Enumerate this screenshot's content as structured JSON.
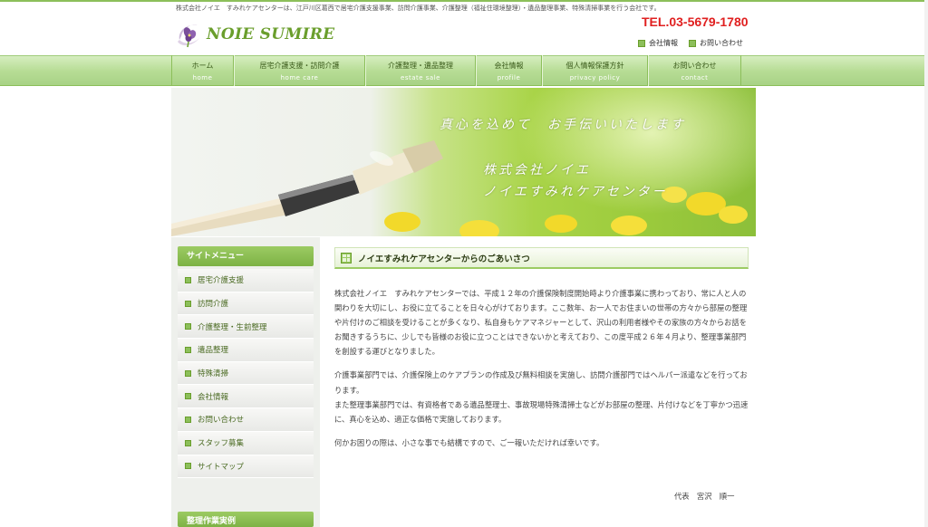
{
  "header": {
    "tagline": "株式会社ノイエ　すみれケアセンターは、江戸川区葛西で居宅介護支援事業、訪問介護事業、介護整理（福祉住環境整理）・遺品整理事業、特殊清掃事業を行う会社です。",
    "logo_text": "NOIE SUMIRE",
    "tel": "TEL.03-5679-1780",
    "links": [
      {
        "label": "会社情報",
        "icon": "square-bullet-icon"
      },
      {
        "label": "お問い合わせ",
        "icon": "square-bullet-icon"
      }
    ]
  },
  "nav": [
    {
      "jp": "ホーム",
      "en": "home"
    },
    {
      "jp": "居宅介護支援・訪問介護",
      "en": "home care"
    },
    {
      "jp": "介護整理・遺品整理",
      "en": "estate sale"
    },
    {
      "jp": "会社情報",
      "en": "profile"
    },
    {
      "jp": "個人情報保護方針",
      "en": "privacy policy"
    },
    {
      "jp": "お問い合わせ",
      "en": "contact"
    }
  ],
  "hero": {
    "line1": "真心を込めて　お手伝いいたします",
    "line2": "株式会社ノイエ",
    "line3": "ノイエすみれケアセンター"
  },
  "sidebar": {
    "menu_title": "サイトメニュー",
    "items": [
      "居宅介護支援",
      "訪問介護",
      "介護整理・生前整理",
      "遺品整理",
      "特殊清掃",
      "会社情報",
      "お問い合わせ",
      "スタッフ募集",
      "サイトマップ"
    ],
    "section2_title": "整理作業実例"
  },
  "main": {
    "heading": "ノイエすみれケアセンターからのごあいさつ",
    "paragraphs": [
      "株式会社ノイエ　すみれケアセンターでは、平成１２年の介護保険制度開始時より介護事業に携わっており、常に人と人の関わりを大切にし、お役に立てることを日々心がけております。ここ数年、お一人でお住まいの世帯の方々から部屋の整理や片付けのご相談を受けることが多くなり、私自身もケアマネジャーとして、沢山の利用者様やその家族の方々からお話をお聞きするうちに、少しでも皆様のお役に立つことはできないかと考えており、この度平成２６年４月より、整理事業部門を創設する運びとなりました。",
      "介護事業部門では、介護保険上のケアプランの作成及び無料相談を実施し、訪問介護部門ではヘルパー派遣などを行っております。",
      "また整理事業部門では、有資格者である遺品整理士、事故現場特殊清掃士などがお部屋の整理、片付けなどを丁寧かつ迅速に、真心を込め、適正な価格で実施しております。",
      "何かお困りの際は、小さな事でも結構ですので、ご一報いただければ幸いです。"
    ],
    "signature": "代表　宮沢　順一"
  },
  "colors": {
    "accent_green": "#8cbf5a",
    "tel_red": "#e02020"
  }
}
